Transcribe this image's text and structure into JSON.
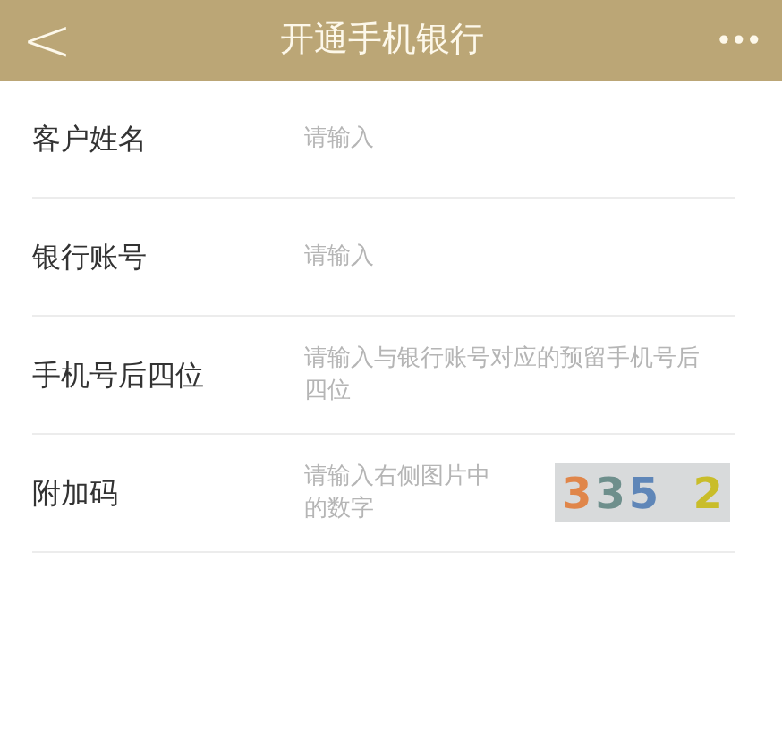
{
  "header": {
    "back": "<",
    "title": "开通手机银行",
    "more": "•••"
  },
  "fields": [
    {
      "kind": "text",
      "label": "客户姓名",
      "placeholder": "请输入"
    },
    {
      "kind": "text",
      "label": "银行账号",
      "placeholder": "请输入"
    },
    {
      "kind": "text",
      "label": "手机号后四位",
      "placeholder": "请输入与银行账号对应的预留手机号后四位"
    },
    {
      "kind": "captcha",
      "label": "附加码",
      "placeholder": "请输入右侧图片中的数字",
      "captcha": [
        {
          "text": "3",
          "color": "#e0864a"
        },
        {
          "text": "3",
          "color": "#6e8f8c"
        },
        {
          "text": "5",
          "color": "#5f86b8"
        },
        {
          "text": "2",
          "color": "#c9bd2a"
        }
      ]
    }
  ]
}
